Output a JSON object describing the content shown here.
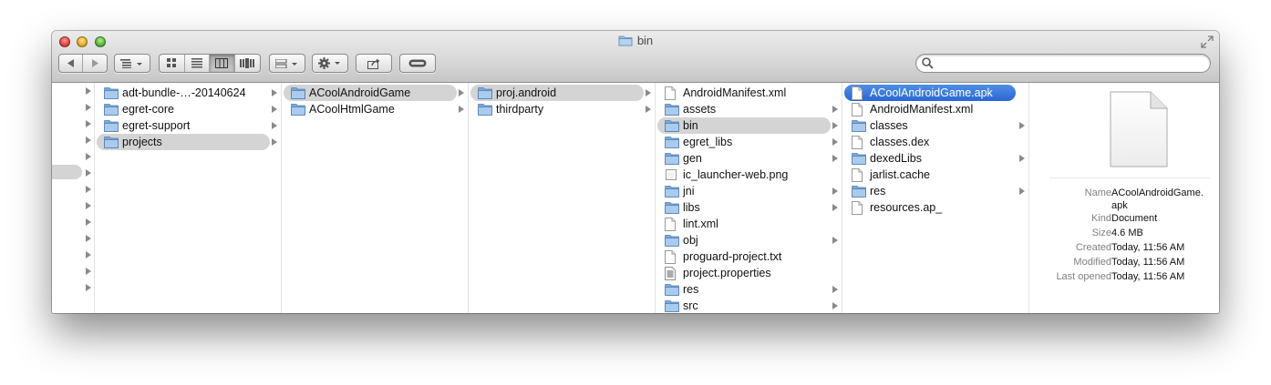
{
  "window": {
    "title": "bin"
  },
  "toolbar": {
    "back_icon": "triangle-left",
    "forward_icon": "triangle-right",
    "arrange_icon": "list-options",
    "view_icons": [
      "icon-view",
      "list-view",
      "column-view",
      "coverflow-view"
    ],
    "active_view": "column-view",
    "group_icon": "group-grid",
    "action_icon": "gear",
    "share_icon": "share-arrow",
    "tags_icon": "tag-pill"
  },
  "search": {
    "value": "",
    "placeholder": ""
  },
  "columns": [
    {
      "items": [
        {
          "label": "adt-bundle-…-20140624",
          "type": "folder"
        },
        {
          "label": "egret-core",
          "type": "folder"
        },
        {
          "label": "egret-support",
          "type": "folder"
        },
        {
          "label": "projects",
          "type": "folder",
          "selected": "gray"
        }
      ]
    },
    {
      "items": [
        {
          "label": "ACoolAndroidGame",
          "type": "folder",
          "selected": "gray"
        },
        {
          "label": "ACoolHtmlGame",
          "type": "folder"
        }
      ]
    },
    {
      "items": [
        {
          "label": "proj.android",
          "type": "folder",
          "selected": "gray"
        },
        {
          "label": "thirdparty",
          "type": "folder"
        }
      ]
    },
    {
      "items": [
        {
          "label": "AndroidManifest.xml",
          "type": "file"
        },
        {
          "label": "assets",
          "type": "folder"
        },
        {
          "label": "bin",
          "type": "folder",
          "selected": "gray"
        },
        {
          "label": "egret_libs",
          "type": "folder"
        },
        {
          "label": "gen",
          "type": "folder"
        },
        {
          "label": "ic_launcher-web.png",
          "type": "image"
        },
        {
          "label": "jni",
          "type": "folder"
        },
        {
          "label": "libs",
          "type": "folder"
        },
        {
          "label": "lint.xml",
          "type": "file"
        },
        {
          "label": "obj",
          "type": "folder"
        },
        {
          "label": "proguard-project.txt",
          "type": "file"
        },
        {
          "label": "project.properties",
          "type": "props"
        },
        {
          "label": "res",
          "type": "folder"
        },
        {
          "label": "src",
          "type": "folder"
        }
      ]
    },
    {
      "items": [
        {
          "label": "ACoolAndroidGame.apk",
          "type": "file",
          "selected": "blue"
        },
        {
          "label": "AndroidManifest.xml",
          "type": "file"
        },
        {
          "label": "classes",
          "type": "folder"
        },
        {
          "label": "classes.dex",
          "type": "file"
        },
        {
          "label": "dexedLibs",
          "type": "folder"
        },
        {
          "label": "jarlist.cache",
          "type": "file"
        },
        {
          "label": "res",
          "type": "folder"
        },
        {
          "label": "resources.ap_",
          "type": "file"
        }
      ]
    }
  ],
  "preview": {
    "icon": "document-icon",
    "info": [
      {
        "key": "Name",
        "value": "ACoolAndroidGame.\napk"
      },
      {
        "key": "Kind",
        "value": "Document"
      },
      {
        "key": "Size",
        "value": "4.6 MB"
      },
      {
        "key": "Created",
        "value": "Today, 11:56 AM"
      },
      {
        "key": "Modified",
        "value": "Today, 11:56 AM"
      },
      {
        "key": "Last opened",
        "value": "Today, 11:56 AM"
      }
    ]
  },
  "colors": {
    "selection_blue": "#3a78dc",
    "selection_gray": "#d4d4d4",
    "folder_blue": "#8fb4dc"
  }
}
